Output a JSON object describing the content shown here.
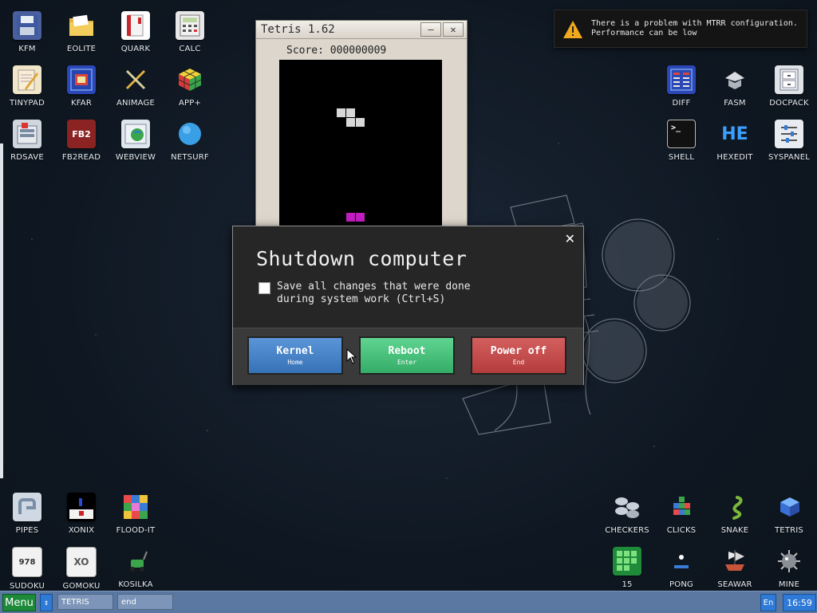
{
  "desktop": {
    "icons_top_left": [
      {
        "label": "KFM"
      },
      {
        "label": "EOLITE"
      },
      {
        "label": "QUARK"
      },
      {
        "label": "CALC"
      },
      {
        "label": "TINYPAD"
      },
      {
        "label": "KFAR"
      },
      {
        "label": "ANIMAGE"
      },
      {
        "label": "APP+"
      },
      {
        "label": "RDSAVE"
      },
      {
        "label": "FB2READ"
      },
      {
        "label": "WEBVIEW"
      },
      {
        "label": "NETSURF"
      }
    ],
    "icons_top_right": [
      {
        "label": "DIFF"
      },
      {
        "label": "FASM"
      },
      {
        "label": "DOCPACK"
      },
      {
        "label": "SHELL"
      },
      {
        "label": "HEXEDIT"
      },
      {
        "label": "SYSPANEL"
      }
    ],
    "icons_bottom_left": [
      {
        "label": "PIPES"
      },
      {
        "label": "XONIX"
      },
      {
        "label": "FLOOD-IT"
      },
      {
        "label": "SUDOKU"
      },
      {
        "label": "GOMOKU"
      },
      {
        "label": "KOSILKA"
      }
    ],
    "icons_bottom_right": [
      {
        "label": "CHECKERS"
      },
      {
        "label": "CLICKS"
      },
      {
        "label": "SNAKE"
      },
      {
        "label": "TETRIS"
      },
      {
        "label": "15"
      },
      {
        "label": "PONG"
      },
      {
        "label": "SEAWAR"
      },
      {
        "label": "MINE"
      }
    ],
    "icon_glyphs": {
      "FB2READ": "FB2",
      "HEXEDIT": "HE",
      "SHELL": ">_",
      "SUDOKU": "978",
      "GOMOKU": "XO"
    }
  },
  "tetris_window": {
    "title": "Tetris 1.62",
    "minimize": "—",
    "close": "✕",
    "score_label": "Score:",
    "score_value": "000000009"
  },
  "notification": {
    "line1": "There is a problem with MTRR configuration.",
    "line2": "Performance can be low"
  },
  "shutdown_dialog": {
    "title": "Shutdown computer",
    "close": "✕",
    "checkbox_text": "Save all changes that were done\nduring system work (Ctrl+S)",
    "checkbox_checked": false,
    "buttons": [
      {
        "label": "Kernel",
        "hint": "Home",
        "color": "#4a86c8"
      },
      {
        "label": "Reboot",
        "hint": "Enter",
        "color": "#48c27c"
      },
      {
        "label": "Power off",
        "hint": "End",
        "color": "#c44c4c"
      }
    ]
  },
  "taskbar": {
    "menu": "Menu",
    "arrows": "↕",
    "tasks": [
      {
        "label": "TETRIS"
      },
      {
        "label": "end"
      }
    ],
    "lang": "En",
    "clock": "16:59"
  },
  "colors": {
    "taskbar": "#5a78a2",
    "menu_button": "#1d8a3a",
    "accent": "#2f7ad6"
  }
}
